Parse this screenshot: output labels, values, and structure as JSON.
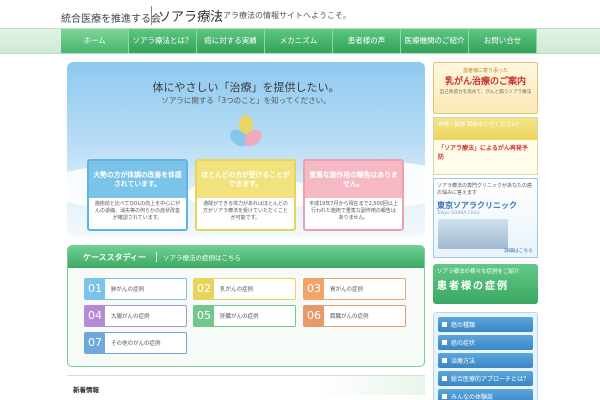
{
  "header": {
    "tagline": "統合医療を推進する会",
    "brand": "ソアラ療法",
    "desc": "ソアラ療法の情報サイトへようこそ。"
  },
  "nav": {
    "items": [
      {
        "label": "ホーム",
        "active": true
      },
      {
        "label": "ソアラ療法とは？",
        "active": false
      },
      {
        "label": "癌に対する実績",
        "active": false
      },
      {
        "label": "メカニズム",
        "active": false
      },
      {
        "label": "患者様の声",
        "active": false
      },
      {
        "label": "医療機関のご紹介",
        "active": false
      },
      {
        "label": "お問い合せ",
        "active": false
      }
    ]
  },
  "hero": {
    "title": "体にやさしい「治療」を提供したい。",
    "subtitle": "ソアラに関する「3つのこと」を知ってください。",
    "cards": [
      {
        "head": "大勢の方が体調の改善を体感されています。",
        "body": "施術前と比べてQOLの向上を中心にがんの退縮、消失等の何らかの症状改善が確認されています。"
      },
      {
        "head": "ほとんどの方が受けることができます。",
        "body": "通院ができる体力があればほとんどの方がソアラ療法を受けていただくことが可能です。"
      },
      {
        "head": "重篤な副作用の報告はありません。",
        "body": "平成19年7月から現在まで2,500回以上行われた施術で重篤な副作用の報告はありません。"
      }
    ]
  },
  "case_study": {
    "title": "ケーススタディー",
    "subtitle": "ソアラ療法の症例はこちら",
    "items": [
      {
        "num": "01",
        "label": "肺がんの症例",
        "color": "#7cc3ea"
      },
      {
        "num": "02",
        "label": "乳がんの症例",
        "color": "#e7d45a"
      },
      {
        "num": "03",
        "label": "胃がんの症例",
        "color": "#f0a46a"
      },
      {
        "num": "04",
        "label": "大腸がんの症例",
        "color": "#b58bd6"
      },
      {
        "num": "05",
        "label": "肝臓がんの症例",
        "color": "#72c88c"
      },
      {
        "num": "06",
        "label": "膵臓がんの症例",
        "color": "#e59a6a"
      },
      {
        "num": "07",
        "label": "その他のがんの症例",
        "color": "#6fa8dc"
      }
    ]
  },
  "news": {
    "label": "新着情報"
  },
  "sidebar": {
    "breast": {
      "line1": "患者様に寄り添った",
      "title": "乳がん治療のご案内",
      "line3": "自己免疫力を高めて、がんと闘うソアラ療法"
    },
    "recurrence": {
      "top": "再発・転移 諦めないでください！",
      "bottom": "「ソアラ療法」によるがん再発予防"
    },
    "clinic": {
      "line1": "ソアラ療法の専門クリニックがあなたの癌の悩みに答えます",
      "name": "東京ソアラクリニック",
      "sub": "Tokyo SOARA Clinic",
      "link": "詳細はこちら"
    },
    "voices": {
      "line1": "ソアラ療法の様々な症例をご紹介",
      "title": "患者様の症例"
    },
    "menu": [
      {
        "label": "癌の種類"
      },
      {
        "label": "癌の症状"
      },
      {
        "label": "治療方法"
      },
      {
        "label": "総合医療的アプローチとは？"
      },
      {
        "label": "みんなの体験談"
      }
    ]
  }
}
